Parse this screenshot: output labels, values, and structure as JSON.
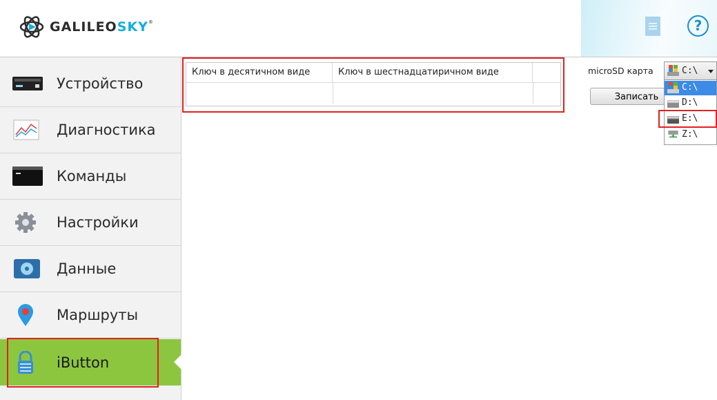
{
  "header": {
    "logo_text_main": "GALILEO",
    "logo_text_accent": "SKY",
    "logo_reg": "®",
    "help_glyph": "?"
  },
  "sidebar": {
    "items": [
      {
        "label": "Устройство",
        "icon": "device-icon"
      },
      {
        "label": "Диагностика",
        "icon": "chart-icon"
      },
      {
        "label": "Команды",
        "icon": "terminal-icon"
      },
      {
        "label": "Настройки",
        "icon": "gear-icon"
      },
      {
        "label": "Данные",
        "icon": "data-icon"
      },
      {
        "label": "Маршруты",
        "icon": "map-pin-icon"
      },
      {
        "label": "iButton",
        "icon": "lock-icon",
        "active": true
      }
    ]
  },
  "table": {
    "columns": [
      "Ключ в десятичном виде",
      "Ключ в шестнадцатиричном виде",
      ""
    ],
    "rows": [
      [
        "",
        "",
        ""
      ]
    ]
  },
  "right_panel": {
    "microsd_label": "microSD карта",
    "drive_selected": "C:\\",
    "drive_options": [
      "C:\\",
      "D:\\",
      "E:\\",
      "Z:\\"
    ],
    "highlighted_option": "C:\\",
    "write_button": "Записать"
  },
  "colors": {
    "active_nav": "#8cc63f",
    "accent": "#12aee0",
    "highlight": "#e02020",
    "selection": "#3c8be6"
  }
}
